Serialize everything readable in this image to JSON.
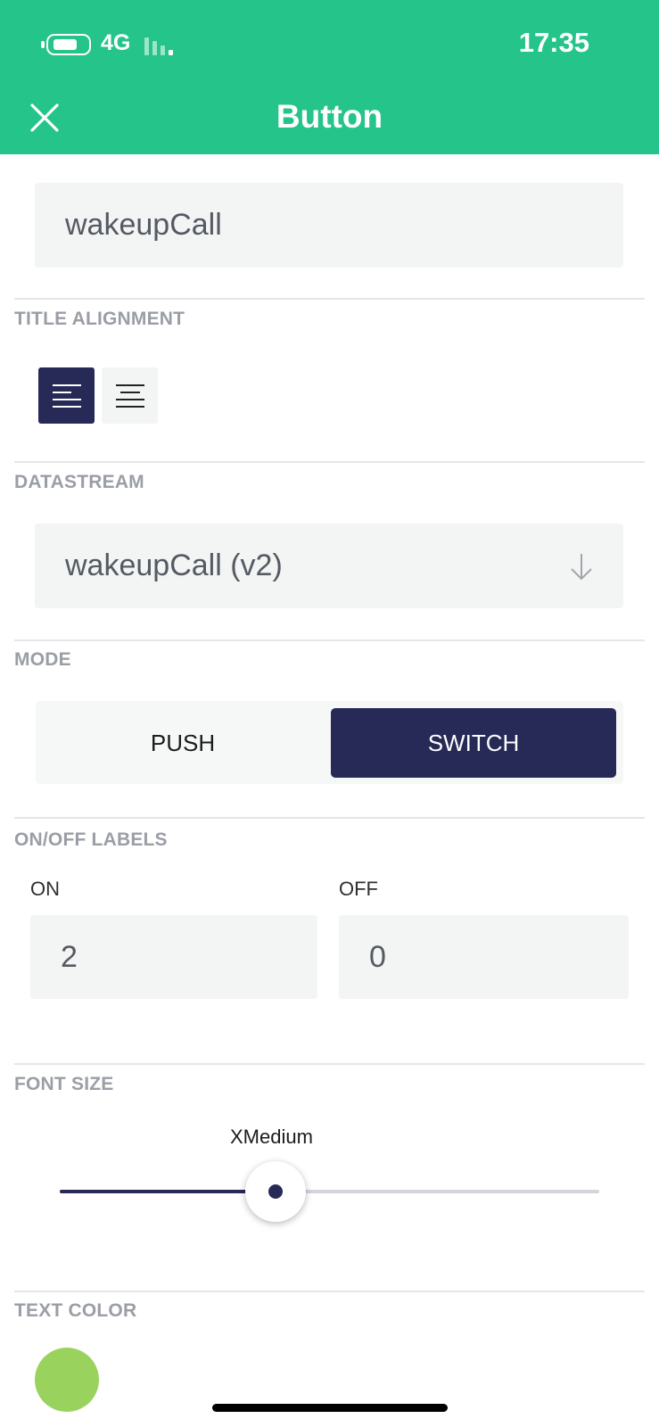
{
  "status_bar": {
    "network": "4G",
    "time": "17:35"
  },
  "header": {
    "title": "Button",
    "close_icon": "close-icon"
  },
  "title_field": {
    "value": "wakeupCall"
  },
  "title_alignment": {
    "label": "TITLE ALIGNMENT",
    "options": [
      "align-left-icon",
      "align-center-icon"
    ],
    "selected": "left"
  },
  "datastream": {
    "label": "DATASTREAM",
    "value": "wakeupCall (v2)",
    "icon": "arrow-down-icon"
  },
  "mode": {
    "label": "MODE",
    "options": [
      "PUSH",
      "SWITCH"
    ],
    "selected": "SWITCH"
  },
  "on_off_labels": {
    "label": "ON/OFF LABELS",
    "on_label": "ON",
    "on_value": "2",
    "off_label": "OFF",
    "off_value": "0"
  },
  "font_size": {
    "label": "FONT SIZE",
    "value": "XMedium",
    "level": 0.4
  },
  "text_color": {
    "label": "TEXT COLOR",
    "color": "#9ad25e"
  },
  "colors": {
    "header": "#25c48a",
    "accent": "#272957"
  }
}
